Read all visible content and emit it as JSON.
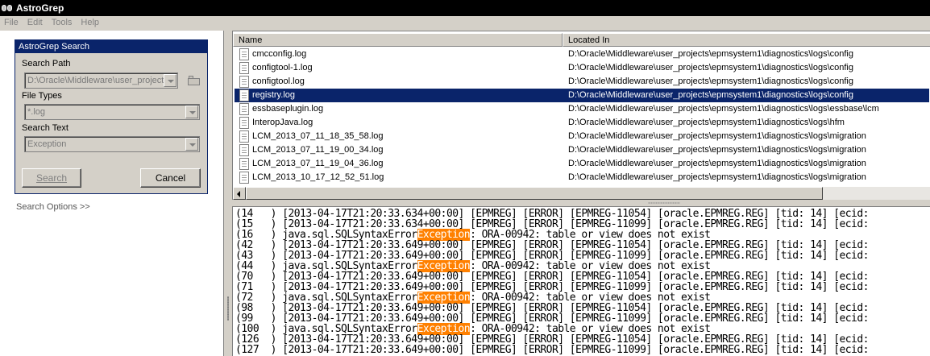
{
  "window": {
    "title": "AstroGrep"
  },
  "menu": [
    "File",
    "Edit",
    "Tools",
    "Help"
  ],
  "search_panel": {
    "header": "AstroGrep Search",
    "path_label": "Search Path",
    "path_value": "D:\\Oracle\\Middleware\\user_projects",
    "filetypes_label": "File Types",
    "filetypes_value": "*.log",
    "searchtext_label": "Search Text",
    "searchtext_value": "Exception",
    "search_button": "Search",
    "cancel_button": "Cancel",
    "options_link": "Search Options >>"
  },
  "file_list": {
    "columns": [
      "Name",
      "Located In"
    ],
    "rows": [
      {
        "name": "cmcconfig.log",
        "location": "D:\\Oracle\\Middleware\\user_projects\\epmsystem1\\diagnostics\\logs\\config"
      },
      {
        "name": "configtool-1.log",
        "location": "D:\\Oracle\\Middleware\\user_projects\\epmsystem1\\diagnostics\\logs\\config"
      },
      {
        "name": "configtool.log",
        "location": "D:\\Oracle\\Middleware\\user_projects\\epmsystem1\\diagnostics\\logs\\config"
      },
      {
        "name": "registry.log",
        "location": "D:\\Oracle\\Middleware\\user_projects\\epmsystem1\\diagnostics\\logs\\config",
        "selected": true
      },
      {
        "name": "essbaseplugin.log",
        "location": "D:\\Oracle\\Middleware\\user_projects\\epmsystem1\\diagnostics\\logs\\essbase\\lcm"
      },
      {
        "name": "InteropJava.log",
        "location": "D:\\Oracle\\Middleware\\user_projects\\epmsystem1\\diagnostics\\logs\\hfm"
      },
      {
        "name": "LCM_2013_07_11_18_35_58.log",
        "location": "D:\\Oracle\\Middleware\\user_projects\\epmsystem1\\diagnostics\\logs\\migration"
      },
      {
        "name": "LCM_2013_07_11_19_00_34.log",
        "location": "D:\\Oracle\\Middleware\\user_projects\\epmsystem1\\diagnostics\\logs\\migration"
      },
      {
        "name": "LCM_2013_07_11_19_04_36.log",
        "location": "D:\\Oracle\\Middleware\\user_projects\\epmsystem1\\diagnostics\\logs\\migration"
      },
      {
        "name": "LCM_2013_10_17_12_52_51.log",
        "location": "D:\\Oracle\\Middleware\\user_projects\\epmsystem1\\diagnostics\\logs\\migration"
      }
    ]
  },
  "results": {
    "highlight": "Exception",
    "lines": [
      {
        "pre": "(14   ) [2013-04-17T21:20:33.634+00:00] [EPMREG] [ERROR] [EPMREG-11054] [oracle.EPMREG.REG] [tid: 14] [ecid:",
        "hl": "",
        "post": ""
      },
      {
        "pre": "(15   ) [2013-04-17T21:20:33.634+00:00] [EPMREG] [ERROR] [EPMREG-11099] [oracle.EPMREG.REG] [tid: 14] [ecid:",
        "hl": "",
        "post": ""
      },
      {
        "pre": "(16   ) java.sql.SQLSyntaxError",
        "hl": "Exception",
        "post": ": ORA-00942: table or view does not exist"
      },
      {
        "pre": "(42   ) [2013-04-17T21:20:33.649+00:00] [EPMREG] [ERROR] [EPMREG-11054] [oracle.EPMREG.REG] [tid: 14] [ecid:",
        "hl": "",
        "post": ""
      },
      {
        "pre": "(43   ) [2013-04-17T21:20:33.649+00:00] [EPMREG] [ERROR] [EPMREG-11099] [oracle.EPMREG.REG] [tid: 14] [ecid:",
        "hl": "",
        "post": ""
      },
      {
        "pre": "(44   ) java.sql.SQLSyntaxError",
        "hl": "Exception",
        "post": ": ORA-00942: table or view does not exist"
      },
      {
        "pre": "(70   ) [2013-04-17T21:20:33.649+00:00] [EPMREG] [ERROR] [EPMREG-11054] [oracle.EPMREG.REG] [tid: 14] [ecid:",
        "hl": "",
        "post": ""
      },
      {
        "pre": "(71   ) [2013-04-17T21:20:33.649+00:00] [EPMREG] [ERROR] [EPMREG-11099] [oracle.EPMREG.REG] [tid: 14] [ecid:",
        "hl": "",
        "post": ""
      },
      {
        "pre": "(72   ) java.sql.SQLSyntaxError",
        "hl": "Exception",
        "post": ": ORA-00942: table or view does not exist"
      },
      {
        "pre": "(98   ) [2013-04-17T21:20:33.649+00:00] [EPMREG] [ERROR] [EPMREG-11054] [oracle.EPMREG.REG] [tid: 14] [ecid:",
        "hl": "",
        "post": ""
      },
      {
        "pre": "(99   ) [2013-04-17T21:20:33.649+00:00] [EPMREG] [ERROR] [EPMREG-11099] [oracle.EPMREG.REG] [tid: 14] [ecid:",
        "hl": "",
        "post": ""
      },
      {
        "pre": "(100  ) java.sql.SQLSyntaxError",
        "hl": "Exception",
        "post": ": ORA-00942: table or view does not exist"
      },
      {
        "pre": "(126  ) [2013-04-17T21:20:33.649+00:00] [EPMREG] [ERROR] [EPMREG-11054] [oracle.EPMREG.REG] [tid: 14] [ecid:",
        "hl": "",
        "post": ""
      },
      {
        "pre": "(127  ) [2013-04-17T21:20:33.649+00:00] [EPMREG] [ERROR] [EPMREG-11099] [oracle.EPMREG.REG] [tid: 14] [ecid:",
        "hl": "",
        "post": ""
      }
    ]
  },
  "colors": {
    "selection": "#0a246a",
    "highlight": "#ff8000",
    "chrome": "#d4d0c8"
  },
  "icons": {
    "app": "binoculars-icon",
    "file": "document-icon",
    "browse": "folder-open-icon"
  }
}
